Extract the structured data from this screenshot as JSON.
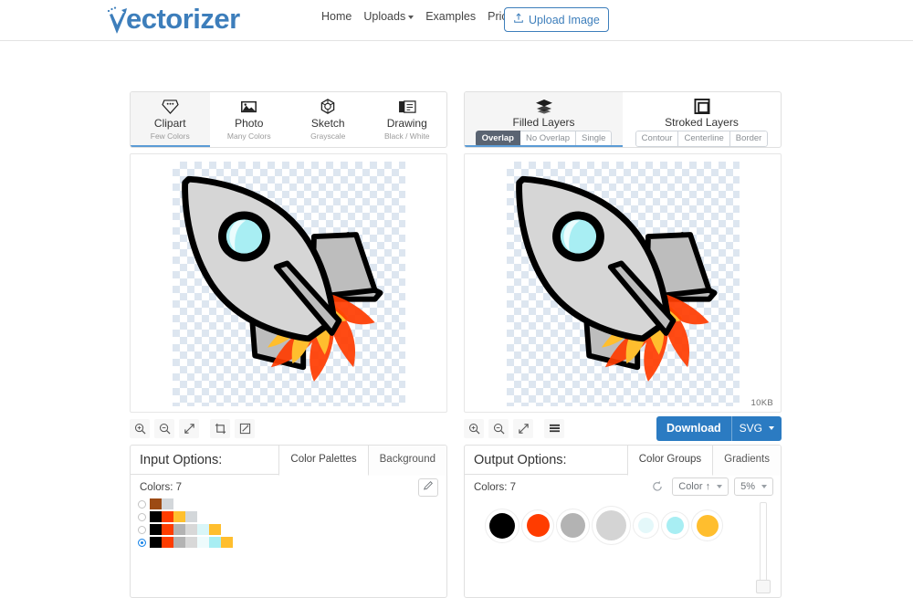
{
  "header": {
    "logo_text": "ectorizer",
    "logo_mark": "v-arrow-logo",
    "nav": [
      {
        "label": "Home",
        "has_caret": false
      },
      {
        "label": "Uploads",
        "has_caret": true
      },
      {
        "label": "Examples",
        "has_caret": false
      },
      {
        "label": "Pricing",
        "has_caret": false
      }
    ],
    "upload_button": "Upload Image"
  },
  "input_panel": {
    "modes": [
      {
        "title": "Clipart",
        "subtitle": "Few Colors",
        "icon": "diamond-icon",
        "active": true
      },
      {
        "title": "Photo",
        "subtitle": "Many Colors",
        "icon": "photo-icon",
        "active": false
      },
      {
        "title": "Sketch",
        "subtitle": "Grayscale",
        "icon": "sketch-icon",
        "active": false
      },
      {
        "title": "Drawing",
        "subtitle": "Black / White",
        "icon": "drawing-icon",
        "active": false
      }
    ],
    "toolbar": [
      {
        "name": "zoom-in-icon"
      },
      {
        "name": "zoom-out-icon"
      },
      {
        "name": "fit-screen-icon"
      },
      {
        "name": "crop-icon"
      },
      {
        "name": "edit-icon"
      }
    ],
    "options": {
      "title": "Input Options:",
      "tabs": [
        {
          "label": "Color Palettes",
          "active": true
        },
        {
          "label": "Background",
          "active": false
        }
      ],
      "colors_label": "Colors: 7",
      "edit_icon": "pencil-icon",
      "palettes": [
        {
          "selected": false,
          "swatches": [
            "#9c4a13",
            "#d3d7da"
          ]
        },
        {
          "selected": false,
          "swatches": [
            "#000000",
            "#ff3c00",
            "#ffc02e",
            "#d3d7da"
          ]
        },
        {
          "selected": false,
          "swatches": [
            "#000000",
            "#ff3c00",
            "#b3b3b3",
            "#d8d8d8",
            "#d9f6f8",
            "#ffbe2e"
          ]
        },
        {
          "selected": true,
          "swatches": [
            "#000000",
            "#ff3c00",
            "#b3b3b3",
            "#d8d8d8",
            "#eefbfc",
            "#a8eef3",
            "#ffbe2e"
          ]
        }
      ]
    }
  },
  "output_panel": {
    "modes": [
      {
        "title": "Filled Layers",
        "icon": "layers-icon",
        "active": true,
        "segments": [
          {
            "label": "Overlap",
            "on": true
          },
          {
            "label": "No Overlap",
            "on": false
          },
          {
            "label": "Single",
            "on": false
          }
        ]
      },
      {
        "title": "Stroked Layers",
        "icon": "stroke-square-icon",
        "active": false,
        "segments": [
          {
            "label": "Contour",
            "on": false
          },
          {
            "label": "Centerline",
            "on": false
          },
          {
            "label": "Border",
            "on": false
          }
        ]
      }
    ],
    "file_size": "10KB",
    "toolbar": [
      {
        "name": "zoom-in-icon"
      },
      {
        "name": "zoom-out-icon"
      },
      {
        "name": "fit-screen-icon"
      },
      {
        "name": "layers-list-icon"
      }
    ],
    "download_button": "Download",
    "download_format": "SVG",
    "options": {
      "title": "Output Options:",
      "tabs": [
        {
          "label": "Color Groups",
          "active": true
        },
        {
          "label": "Gradients",
          "active": false
        }
      ],
      "colors_label": "Colors: 7",
      "reset_icon": "reset-icon",
      "sort_button": "Color ↑",
      "threshold_button": "5%",
      "color_groups": [
        {
          "color": "#000000",
          "dot": 28,
          "ring": 38
        },
        {
          "color": "#ff3c00",
          "dot": 25,
          "ring": 36
        },
        {
          "color": "#b3b3b3",
          "dot": 27,
          "ring": 37
        },
        {
          "color": "#d4d4d4",
          "dot": 33,
          "ring": 43
        },
        {
          "color": "#e4f8fa",
          "dot": 17,
          "ring": 29
        },
        {
          "color": "#a8eef3",
          "dot": 19,
          "ring": 31
        },
        {
          "color": "#ffbe2e",
          "dot": 24,
          "ring": 35
        }
      ]
    }
  },
  "artwork": {
    "name": "rocket-clipart",
    "colors": {
      "outline": "#000000",
      "body_light": "#d6d6d6",
      "body_mid": "#bdbdbd",
      "window_outer": "#a8eef3",
      "window_inner": "#eafcfd",
      "flame_orange": "#ff3c00",
      "flame_yellow": "#ffbe2e"
    }
  },
  "theme": {
    "brand_blue": "#3d7ebb",
    "button_blue": "#2b7bc2",
    "accent_tab": "#5b9bd5",
    "segment_on": "#5a6472"
  }
}
